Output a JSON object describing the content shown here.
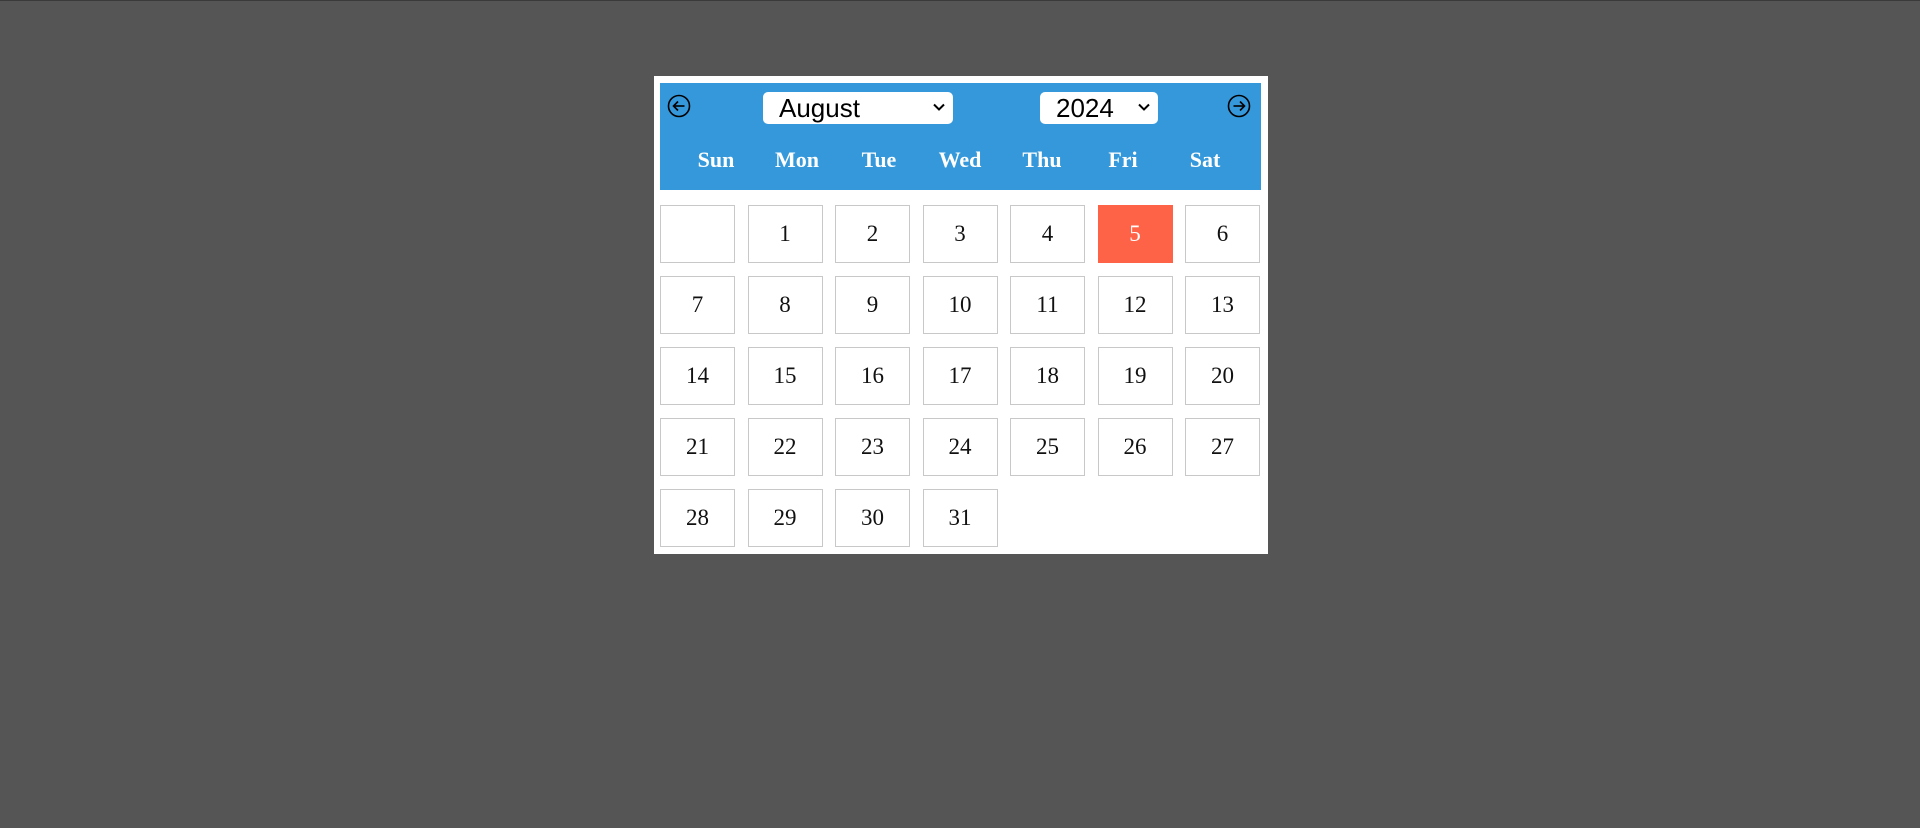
{
  "calendar": {
    "month": "August",
    "year": "2024",
    "weekdays": [
      "Sun",
      "Mon",
      "Tue",
      "Wed",
      "Thu",
      "Fri",
      "Sat"
    ],
    "leading_blanks": 1,
    "days": [
      "1",
      "2",
      "3",
      "4",
      "5",
      "6",
      "7",
      "8",
      "9",
      "10",
      "11",
      "12",
      "13",
      "14",
      "15",
      "16",
      "17",
      "18",
      "19",
      "20",
      "21",
      "22",
      "23",
      "24",
      "25",
      "26",
      "27",
      "28",
      "29",
      "30",
      "31"
    ],
    "selected_day": "5"
  },
  "colors": {
    "background": "#555555",
    "header": "#3498db",
    "selected": "#ff6347"
  },
  "icons": {
    "prev": "circle-arrow-left-icon",
    "next": "circle-arrow-right-icon",
    "dropdown": "chevron-down-icon"
  }
}
